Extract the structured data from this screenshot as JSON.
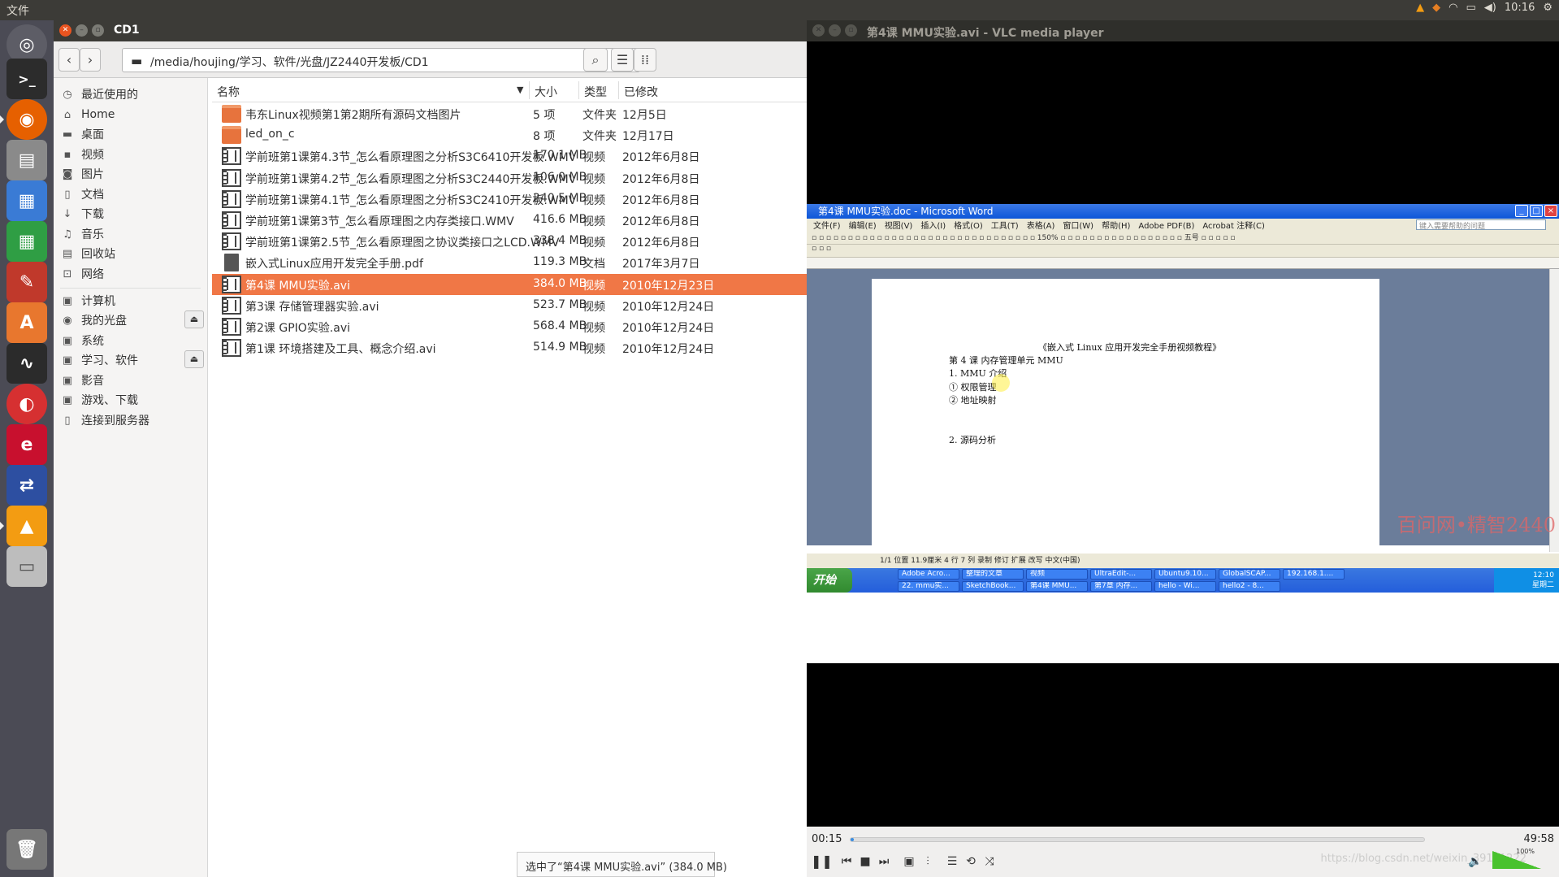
{
  "topbar": {
    "menu": "文件",
    "clock": "10:16"
  },
  "launcher": {
    "icons": [
      "dash-icon",
      "terminal-icon",
      "firefox-icon",
      "files-icon",
      "viewer-icon",
      "spreadsheet-icon",
      "settings-icon",
      "software-center-icon",
      "system-monitor-icon",
      "netease-music-icon",
      "editor-icon",
      "remote-desktop-icon",
      "vlc-icon",
      "disk-icon",
      "trash-icon"
    ]
  },
  "nautilus": {
    "title": "CD1",
    "path": "/media/houjing/学习、软件/光盘/JZ2440开发板/CD1",
    "sidebar": {
      "items": [
        "最近使用的",
        "Home",
        "桌面",
        "视频",
        "图片",
        "文档",
        "下载",
        "音乐",
        "回收站",
        "网络"
      ],
      "devices": [
        "计算机",
        "我的光盘",
        "系统",
        "学习、软件",
        "影音",
        "游戏、下载",
        "连接到服务器"
      ]
    },
    "columns": {
      "name": "名称",
      "size": "大小",
      "type": "类型",
      "modified": "已修改"
    },
    "files": [
      {
        "name": "韦东Linux视频第1第2期所有源码文档图片",
        "size": "5 项",
        "type": "文件夹",
        "modified": "12月5日",
        "icon": "folder"
      },
      {
        "name": "led_on_c",
        "size": "8 项",
        "type": "文件夹",
        "modified": "12月17日",
        "icon": "folder"
      },
      {
        "name": "学前班第1课第4.3节_怎么看原理图之分析S3C6410开发板.WMV",
        "size": "170.1 MB",
        "type": "视频",
        "modified": "2012年6月8日",
        "icon": "video"
      },
      {
        "name": "学前班第1课第4.2节_怎么看原理图之分析S3C2440开发板.WMV",
        "size": "106.0 MB",
        "type": "视频",
        "modified": "2012年6月8日",
        "icon": "video"
      },
      {
        "name": "学前班第1课第4.1节_怎么看原理图之分析S3C2410开发板.WMV",
        "size": "240.5 MB",
        "type": "视频",
        "modified": "2012年6月8日",
        "icon": "video"
      },
      {
        "name": "学前班第1课第3节_怎么看原理图之内存类接口.WMV",
        "size": "416.6 MB",
        "type": "视频",
        "modified": "2012年6月8日",
        "icon": "video"
      },
      {
        "name": "学前班第1课第2.5节_怎么看原理图之协议类接口之LCD.WMV",
        "size": "338.4 MB",
        "type": "视频",
        "modified": "2012年6月8日",
        "icon": "video"
      },
      {
        "name": "嵌入式Linux应用开发完全手册.pdf",
        "size": "119.3 MB",
        "type": "文档",
        "modified": "2017年3月7日",
        "icon": "pdf"
      },
      {
        "name": "第4课 MMU实验.avi",
        "size": "384.0 MB",
        "type": "视频",
        "modified": "2010年12月23日",
        "icon": "video",
        "selected": true
      },
      {
        "name": "第3课 存储管理器实验.avi",
        "size": "523.7 MB",
        "type": "视频",
        "modified": "2010年12月24日",
        "icon": "video"
      },
      {
        "name": "第2课 GPIO实验.avi",
        "size": "568.4 MB",
        "type": "视频",
        "modified": "2010年12月24日",
        "icon": "video"
      },
      {
        "name": "第1课 环境搭建及工具、概念介绍.avi",
        "size": "514.9 MB",
        "type": "视频",
        "modified": "2010年12月24日",
        "icon": "video"
      }
    ],
    "status": "选中了“第4课 MMU实验.avi” (384.0 MB)"
  },
  "vlc": {
    "title": "第4课 MMU实验.avi - VLC media player",
    "elapsed": "00:15",
    "total": "49:58",
    "progress": 0.005,
    "volume_label": "100%",
    "overlay": "https://blog.csdn.net/weixin_39191222",
    "video": {
      "word_title": "第4课 MMU实验.doc - Microsoft Word",
      "menu": [
        "文件(F)",
        "编辑(E)",
        "视图(V)",
        "插入(I)",
        "格式(O)",
        "工具(T)",
        "表格(A)",
        "窗口(W)",
        "帮助(H)",
        "Adobe PDF(B)",
        "Acrobat 注释(C)"
      ],
      "help_placeholder": "键入需要帮助的问题",
      "zoom": "150%",
      "font_size": "五号",
      "doc_lines": [
        "《嵌入式 Linux 应用开发完全手册视频教程》",
        "第 4 课  内存管理单元 MMU",
        "1.   MMU 介绍",
        "①   权限管理",
        "②   地址映射",
        "2.   源码分析"
      ],
      "status": "1/1    位置 11.9厘米    4 行    7 列    录制  修订  扩展  改写   中文(中国)",
      "start_label": "开始",
      "tasks": [
        "Adobe Acro...",
        "整理的文章",
        "视频",
        "UltraEdit-...",
        "Ubuntu9.10...",
        "GlobalSCAP...",
        "192.168.1....",
        "22. mmu实...",
        "SketchBook...",
        "第4课 MMU...",
        "第7章 内存...",
        "hello - Wi...",
        "hello2 - 8..."
      ],
      "clock_time": "12:10",
      "clock_day": "星期二",
      "watermark": "百问网•精智2440"
    }
  }
}
